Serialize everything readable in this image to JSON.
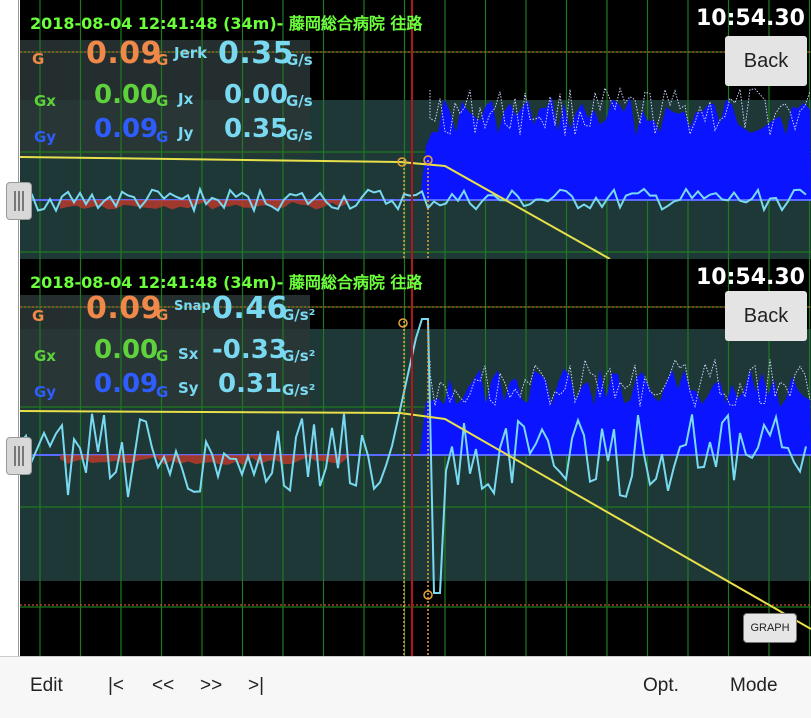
{
  "top_panel": {
    "header": "2018-08-04 12:41:48 (34m)- 藤岡総合病院 往路",
    "clock": "10:54.30",
    "back_label": "Back",
    "g_label": "G",
    "g_value": "0.09",
    "g_unit": "G",
    "jerk_label": "Jerk",
    "jerk_value": "0.35",
    "jerk_unit": "G/s",
    "gx_label": "Gx",
    "gx_value": "0.00",
    "gx_unit": "G",
    "jx_label": "Jx",
    "jx_value": "0.00",
    "jx_unit": "G/s",
    "gy_label": "Gy",
    "gy_value": "0.09",
    "gy_unit": "G",
    "jy_label": "Jy",
    "jy_value": "0.35",
    "jy_unit": "G/s"
  },
  "bottom_panel": {
    "header": "2018-08-04 12:41:48 (34m)- 藤岡総合病院 往路",
    "clock": "10:54.30",
    "back_label": "Back",
    "g_label": "G",
    "g_value": "0.09",
    "g_unit": "G",
    "snap_label": "Snap",
    "snap_value": "0.46",
    "snap_unit": "G/s²",
    "gx_label": "Gx",
    "gx_value": "0.00",
    "gx_unit": "G",
    "sx_label": "Sx",
    "sx_value": "-0.33",
    "sx_unit": "G/s²",
    "gy_label": "Gy",
    "gy_value": "0.09",
    "gy_unit": "G",
    "sy_label": "Sy",
    "sy_value": "0.31",
    "sy_unit": "G/s²",
    "graph_button": "GRAPH"
  },
  "toolbar": {
    "edit": "Edit",
    "first": "|<",
    "prev": "<<",
    "next": ">>",
    "last": ">|",
    "options": "Opt.",
    "mode": "Mode"
  },
  "colors": {
    "header_green": "#6cff3c",
    "g_orange": "#f0884a",
    "gx_green": "#5fd13c",
    "gy_blue": "#2f5cff",
    "cyan": "#79d9f0",
    "fill_blue": "#0a14ff",
    "speed_yellow": "#e8e04a",
    "cursor_red": "#b01818"
  }
}
